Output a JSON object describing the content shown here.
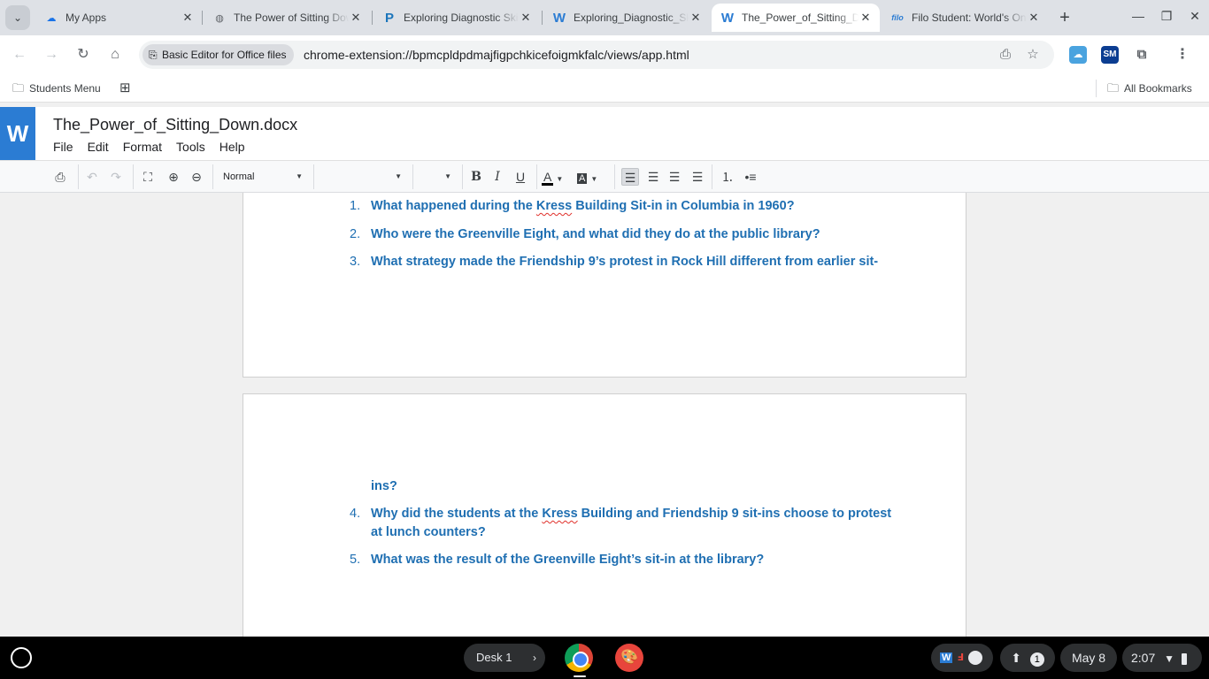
{
  "browser": {
    "tabs": [
      {
        "title": "My Apps",
        "favicon": "cloud-icon",
        "active": false
      },
      {
        "title": "The Power of Sitting Down",
        "favicon": "globe-icon",
        "active": false
      },
      {
        "title": "Exploring Diagnostic Skills",
        "favicon": "p-logo-icon",
        "active": false
      },
      {
        "title": "Exploring_Diagnostic_Skills",
        "favicon": "word-icon",
        "active": false
      },
      {
        "title": "The_Power_of_Sitting_Down",
        "favicon": "word-icon",
        "active": true
      },
      {
        "title": "Filo Student: World's Only",
        "favicon": "filo-icon",
        "active": false
      }
    ],
    "chip_label": "Basic Editor for Office files",
    "url": "chrome-extension://bpmcpldpdmajfigpchkicefoigmkfalc/views/app.html",
    "bookmarks": {
      "students_menu": "Students Menu",
      "all_bookmarks": "All Bookmarks"
    }
  },
  "app": {
    "logo_letter": "W",
    "doc_name": "The_Power_of_Sitting_Down.docx",
    "menu": [
      "File",
      "Edit",
      "Format",
      "Tools",
      "Help"
    ],
    "style_dropdown": "Normal",
    "font_dropdown": "",
    "size_dropdown": ""
  },
  "document": {
    "page1": [
      {
        "num": "1.",
        "pre": "What happened during the ",
        "squiggle": "Kress",
        "post": " Building Sit-in in Columbia in 1960?"
      },
      {
        "num": "2.",
        "pre": "Who were the Greenville Eight, and what did they do at the public library?",
        "squiggle": "",
        "post": ""
      },
      {
        "num": "3.",
        "pre": "What strategy made the Friendship 9’s protest in Rock Hill different from earlier sit-",
        "squiggle": "",
        "post": ""
      }
    ],
    "page2_continuation": "ins?",
    "page2": [
      {
        "num": "4.",
        "pre": "Why did the students at the ",
        "squiggle": "Kress",
        "post": " Building and Friendship 9 sit-ins choose to protest at lunch counters?"
      },
      {
        "num": "5.",
        "pre": "What was the result of the Greenville Eight’s sit-in at the library?",
        "squiggle": "",
        "post": ""
      }
    ]
  },
  "shelf": {
    "desk_label": "Desk 1",
    "notification_count": "1",
    "date": "May 8",
    "time": "2:07"
  },
  "colors": {
    "question_text": "#1f6fb2",
    "word_blue": "#2b7cd3",
    "spell_error": "#e0302a"
  }
}
